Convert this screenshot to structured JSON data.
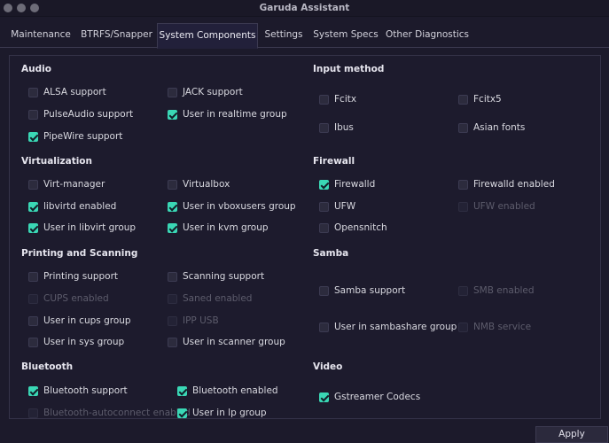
{
  "window": {
    "title": "Garuda Assistant"
  },
  "tabs": [
    "Maintenance",
    "BTRFS/Snapper",
    "System Components",
    "Settings",
    "System Specs",
    "Other Diagnostics"
  ],
  "sections": {
    "audio": {
      "title": "Audio"
    },
    "virtualization": {
      "title": "Virtualization"
    },
    "printing": {
      "title": "Printing and Scanning"
    },
    "bluetooth": {
      "title": "Bluetooth"
    },
    "input": {
      "title": "Input method"
    },
    "firewall": {
      "title": "Firewall"
    },
    "samba": {
      "title": "Samba"
    },
    "video": {
      "title": "Video"
    }
  },
  "items": {
    "alsa": {
      "label": "ALSA support",
      "checked": false,
      "enabled": true
    },
    "jack": {
      "label": "JACK support",
      "checked": false,
      "enabled": true
    },
    "pulseaudio": {
      "label": "PulseAudio support",
      "checked": false,
      "enabled": true
    },
    "realtime": {
      "label": "User in realtime group",
      "checked": true,
      "enabled": true
    },
    "pipewire": {
      "label": "PipeWire support",
      "checked": true,
      "enabled": true
    },
    "virtmanager": {
      "label": "Virt-manager",
      "checked": false,
      "enabled": true
    },
    "virtualbox": {
      "label": "Virtualbox",
      "checked": false,
      "enabled": true
    },
    "libvirtd": {
      "label": "libvirtd enabled",
      "checked": true,
      "enabled": true
    },
    "vboxusers": {
      "label": "User in vboxusers group",
      "checked": true,
      "enabled": true
    },
    "libvirtgroup": {
      "label": "User in libvirt group",
      "checked": true,
      "enabled": true
    },
    "kvm": {
      "label": "User in kvm group",
      "checked": true,
      "enabled": true
    },
    "printing": {
      "label": "Printing support",
      "checked": false,
      "enabled": true
    },
    "scanning": {
      "label": "Scanning support",
      "checked": false,
      "enabled": true
    },
    "cups": {
      "label": "CUPS enabled",
      "checked": false,
      "enabled": false
    },
    "saned": {
      "label": "Saned enabled",
      "checked": false,
      "enabled": false
    },
    "cupsgroup": {
      "label": "User in cups group",
      "checked": false,
      "enabled": true
    },
    "ippusb": {
      "label": "IPP USB",
      "checked": false,
      "enabled": false
    },
    "sysgroup": {
      "label": "User in sys group",
      "checked": false,
      "enabled": true
    },
    "scannergroup": {
      "label": "User in scanner group",
      "checked": false,
      "enabled": true
    },
    "btsupport": {
      "label": "Bluetooth support",
      "checked": true,
      "enabled": true
    },
    "btenabled": {
      "label": "Bluetooth enabled",
      "checked": true,
      "enabled": true
    },
    "btauto": {
      "label": "Bluetooth-autoconnect enabled",
      "checked": false,
      "enabled": false
    },
    "lpgroup": {
      "label": "User in lp group",
      "checked": true,
      "enabled": true
    },
    "fcitx": {
      "label": "Fcitx",
      "checked": false,
      "enabled": true
    },
    "fcitx5": {
      "label": "Fcitx5",
      "checked": false,
      "enabled": true
    },
    "ibus": {
      "label": "Ibus",
      "checked": false,
      "enabled": true
    },
    "asianfonts": {
      "label": "Asian fonts",
      "checked": false,
      "enabled": true
    },
    "firewalld": {
      "label": "Firewalld",
      "checked": true,
      "enabled": true
    },
    "firewalldenabled": {
      "label": "Firewalld enabled",
      "checked": false,
      "enabled": true
    },
    "ufw": {
      "label": "UFW",
      "checked": false,
      "enabled": true
    },
    "ufwenabled": {
      "label": "UFW enabled",
      "checked": false,
      "enabled": false
    },
    "opensnitch": {
      "label": "Opensnitch",
      "checked": false,
      "enabled": true
    },
    "samba": {
      "label": "Samba support",
      "checked": false,
      "enabled": true
    },
    "smb": {
      "label": "SMB enabled",
      "checked": false,
      "enabled": false
    },
    "sambashare": {
      "label": "User in sambashare group",
      "checked": false,
      "enabled": true
    },
    "nmb": {
      "label": "NMB service",
      "checked": false,
      "enabled": false
    },
    "gstreamer": {
      "label": "Gstreamer Codecs",
      "checked": true,
      "enabled": true
    }
  },
  "footer": {
    "apply_label": "Apply"
  }
}
